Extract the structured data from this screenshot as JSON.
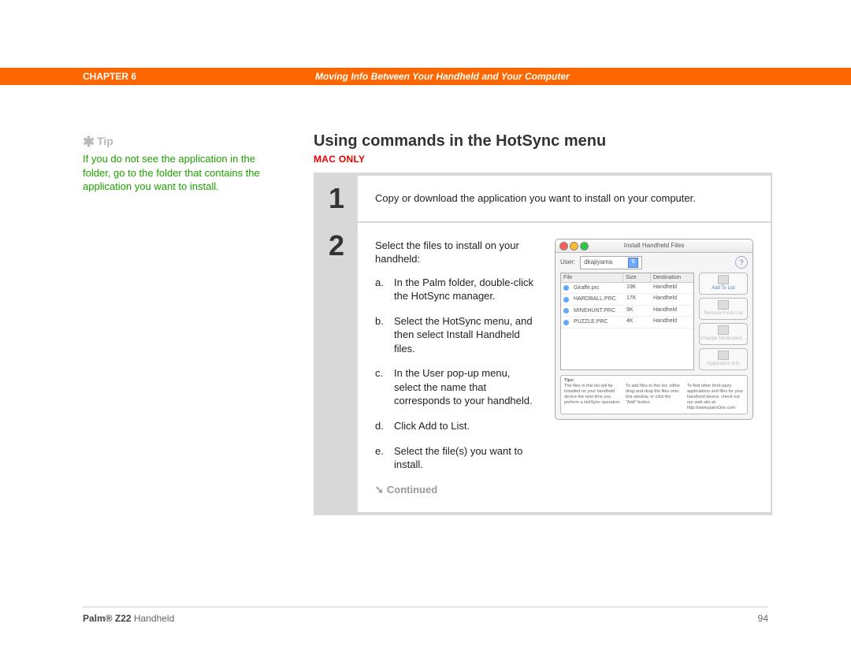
{
  "header": {
    "chapter": "CHAPTER 6",
    "title": "Moving Info Between Your Handheld and Your Computer"
  },
  "sidebar": {
    "tip_label": "Tip",
    "tip_body": "If you do not see the application in the folder, go to the folder that contains the application you want to install."
  },
  "main": {
    "section_title": "Using commands in the HotSync menu",
    "mac_only": "MAC ONLY",
    "step1": {
      "num": "1",
      "text": "Copy or download the application you want to install on your computer."
    },
    "step2": {
      "num": "2",
      "lead": "Select the files to install on your handheld:",
      "items": [
        {
          "label": "a.",
          "text": "In the Palm folder, double-click the HotSync manager."
        },
        {
          "label": "b.",
          "text": "Select the HotSync menu, and then select Install Handheld files."
        },
        {
          "label": "c.",
          "text": "In the User pop-up menu, select the name that corresponds to your handheld."
        },
        {
          "label": "d.",
          "text": "Click Add to List."
        },
        {
          "label": "e.",
          "text": "Select the file(s) you want to install."
        }
      ],
      "continued": "Continued"
    }
  },
  "macwin": {
    "title": "Install Handheld Files",
    "user_label": "User:",
    "user_value": "dkajiyama",
    "columns": [
      "File",
      "Size",
      "Destination"
    ],
    "rows": [
      {
        "name": "Giraffe.prc",
        "size": "19K",
        "dest": "Handheld"
      },
      {
        "name": "HARDBALL.PRC",
        "size": "17K",
        "dest": "Handheld"
      },
      {
        "name": "MINEHUNT.PRC",
        "size": "9K",
        "dest": "Handheld"
      },
      {
        "name": "PUZZLE.PRC",
        "size": "4K",
        "dest": "Handheld"
      }
    ],
    "buttons": {
      "add": "Add To List",
      "remove": "Remove From List",
      "change": "Change Destination...",
      "info": "Application Info"
    },
    "tips_title": "Tips:",
    "tips_cols": [
      "The files in this list will be installed on your handheld device the next time you perform a HotSync operation.",
      "To add files to this list, either drag-and-drop the files onto this window, or click the \"Add\" button.",
      "To find other third-party applications and files for your handheld device, check out our web site at: http://www.palmOne.com"
    ]
  },
  "footer": {
    "product_bold": "Palm® Z22",
    "product_rest": " Handheld",
    "page": "94"
  }
}
